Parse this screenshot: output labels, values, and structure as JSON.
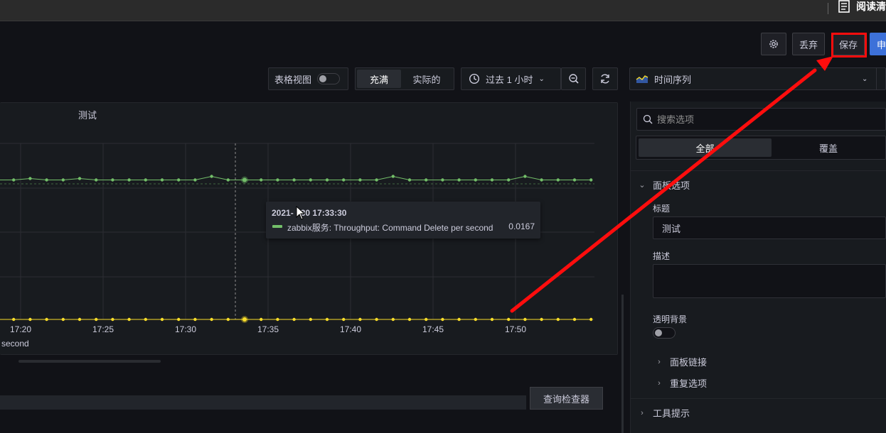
{
  "topbar": {
    "reader_label": "阅读清"
  },
  "toolbar": {
    "discard_label": "丢弃",
    "save_label": "保存",
    "apply_label": "申"
  },
  "view_controls": {
    "table_view_label": "表格视图",
    "table_view_on": false,
    "fill_label": "充满",
    "actual_label": "实际的",
    "time_range_label": "过去 1 小时",
    "visualization_label": "时间序列"
  },
  "panel": {
    "title": "测试",
    "legend_text": "second",
    "tooltip": {
      "time": "2021-",
      "time_rest": "30 17:33:30",
      "series_name": "zabbix服务: Throughput: Command Delete per second",
      "value": "0.0167"
    },
    "query_inspector_label": "查询检查器"
  },
  "chart_data": {
    "type": "line",
    "x_ticks": [
      "17:20",
      "17:25",
      "17:30",
      "17:35",
      "17:40",
      "17:45",
      "17:50"
    ],
    "series": [
      {
        "color": "#73bf69",
        "values": [
          0,
          0,
          0.08,
          0,
          0,
          0.08,
          0,
          0,
          0,
          0,
          0,
          0,
          0,
          0.2,
          0,
          0,
          0,
          0,
          0,
          0,
          0,
          0,
          0,
          0,
          0.2,
          0,
          0,
          0,
          0,
          0,
          0,
          0,
          0.2,
          0,
          0,
          0,
          0
        ]
      },
      {
        "color": "#fade2a",
        "values": [
          0,
          0,
          0,
          0,
          0,
          0,
          0,
          0,
          0,
          0,
          0,
          0,
          0,
          0,
          0,
          0,
          0,
          0,
          0,
          0,
          0,
          0,
          0,
          0,
          0,
          0,
          0,
          0,
          0,
          0,
          0,
          0,
          0,
          0,
          0,
          0,
          0
        ]
      }
    ]
  },
  "options": {
    "search_placeholder": "搜索选项",
    "tab_all": "全部",
    "tab_overrides": "覆盖",
    "panel_options_label": "面板选项",
    "title_label": "标题",
    "title_value": "测试",
    "description_label": "描述",
    "description_value": "",
    "transparent_label": "透明背景",
    "transparent_on": false,
    "panel_links_label": "面板链接",
    "repeat_options_label": "重复选项",
    "tooltip_section_label": "工具提示"
  },
  "colors": {
    "accent": "#3d71d9",
    "annotation": "#ff0d0d",
    "series_green": "#73bf69",
    "series_yellow": "#fade2a"
  }
}
